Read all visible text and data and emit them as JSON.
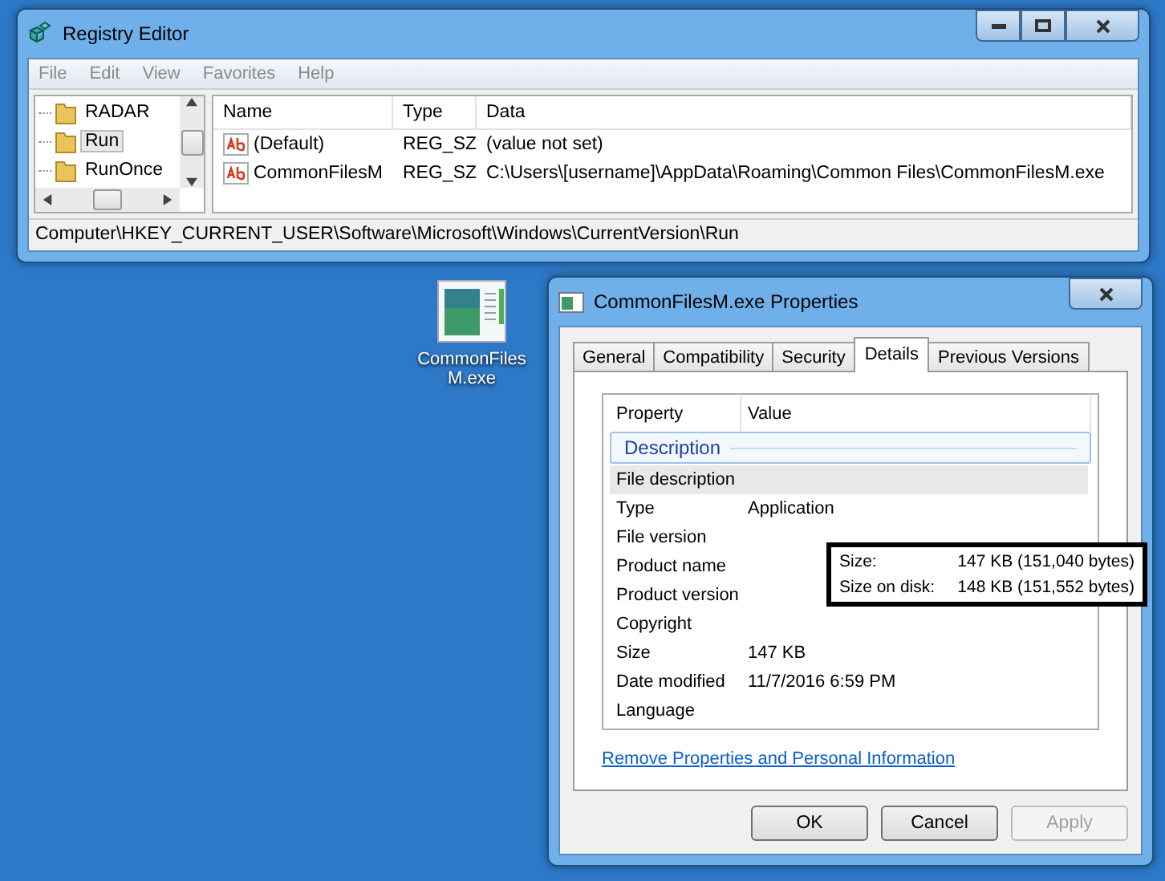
{
  "registry_window": {
    "title": "Registry Editor",
    "menu": [
      "File",
      "Edit",
      "View",
      "Favorites",
      "Help"
    ],
    "tree": [
      {
        "label": "RADAR",
        "selected": false
      },
      {
        "label": "Run",
        "selected": true
      },
      {
        "label": "RunOnce",
        "selected": false
      }
    ],
    "columns": [
      "Name",
      "Type",
      "Data"
    ],
    "rows": [
      {
        "name": "(Default)",
        "type": "REG_SZ",
        "data": "(value not set)"
      },
      {
        "name": "CommonFilesM",
        "type": "REG_SZ",
        "data": "C:\\Users\\[username]\\AppData\\Roaming\\Common Files\\CommonFilesM.exe"
      }
    ],
    "status_bar": "Computer\\HKEY_CURRENT_USER\\Software\\Microsoft\\Windows\\CurrentVersion\\Run"
  },
  "desktop_icon": {
    "label": "CommonFilesM.exe"
  },
  "properties_window": {
    "title": "CommonFilesM.exe Properties",
    "tabs": [
      {
        "label": "General",
        "selected": false
      },
      {
        "label": "Compatibility",
        "selected": false
      },
      {
        "label": "Security",
        "selected": false
      },
      {
        "label": "Details",
        "selected": true
      },
      {
        "label": "Previous Versions",
        "selected": false
      }
    ],
    "columns": [
      "Property",
      "Value"
    ],
    "group": "Description",
    "rows": [
      {
        "property": "File description",
        "selected": true
      },
      {
        "property": "Type",
        "value": "Application",
        "selected": false
      },
      {
        "property": "File version",
        "selected": false
      },
      {
        "property": "Product name",
        "selected": false
      },
      {
        "property": "Product version",
        "selected": false
      },
      {
        "property": "Copyright",
        "selected": false
      },
      {
        "property": "Size",
        "value": "147 KB",
        "selected": false
      },
      {
        "property": "Date modified",
        "value": "11/7/2016 6:59 PM",
        "selected": false
      },
      {
        "property": "Language",
        "selected": false
      }
    ],
    "link": "Remove Properties and Personal Information",
    "buttons": [
      {
        "label": "OK",
        "disabled": false
      },
      {
        "label": "Cancel",
        "disabled": false
      },
      {
        "label": "Apply",
        "disabled": true
      }
    ]
  },
  "annotation": {
    "rows": [
      {
        "label": "Size:",
        "value": "147 KB (151,040 bytes)"
      },
      {
        "label": "Size on disk:",
        "value": "148 KB (151,552 bytes)"
      }
    ]
  }
}
